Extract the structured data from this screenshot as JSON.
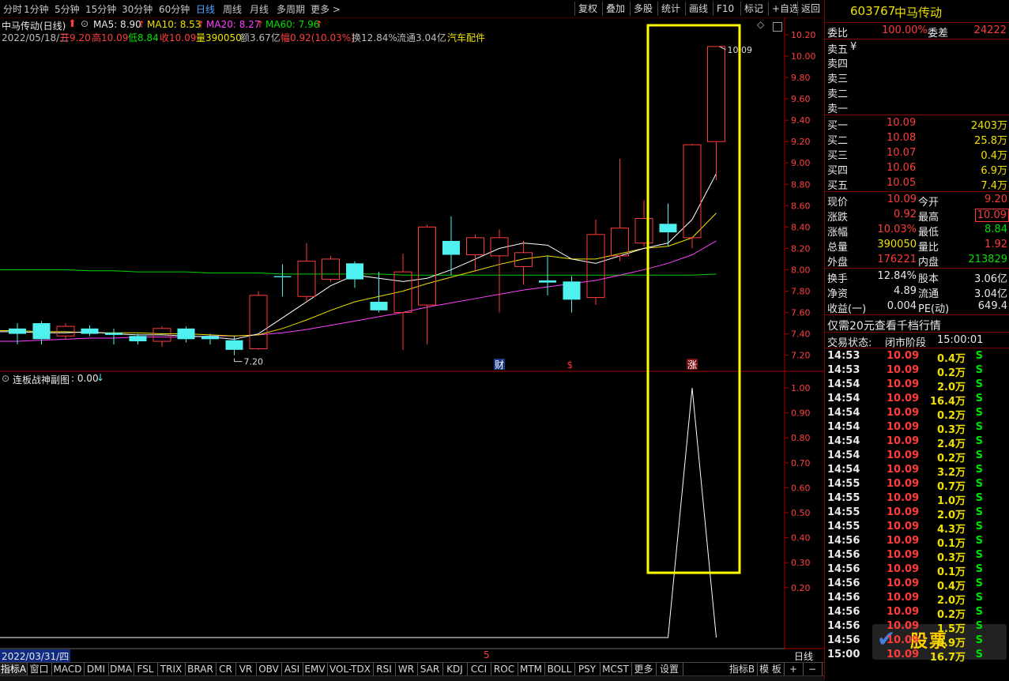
{
  "topbar": {
    "periods": [
      "分时",
      "1分钟",
      "5分钟",
      "15分钟",
      "30分钟",
      "60分钟",
      "日线",
      "周线",
      "月线",
      "多周期",
      "更多 >"
    ],
    "active_index": 6,
    "tools": [
      "复权",
      "叠加",
      "多股",
      "统计",
      "画线",
      "F10",
      "标记",
      "+自选",
      "返回"
    ]
  },
  "info": {
    "title": "中马传动(日线)",
    "ma5": "MA5: 8.90",
    "ma10": "MA10: 8.53",
    "ma20": "MA20: 8.27",
    "ma60": "MA60: 7.96",
    "date": "2022/05/18/三",
    "open": "开9.20",
    "high": "高10.09",
    "low": "低8.84",
    "close": "收10.09",
    "vol": "量390050",
    "amount": "额3.67亿",
    "change": "幅0.92(10.03%)",
    "turnover": "换12.84%",
    "float": "流通3.04亿",
    "sector": "汽车配件"
  },
  "sub": {
    "title": "连板战神副图",
    "value": ": 0.00",
    "arrow": "↓"
  },
  "colors": {
    "up": "#ff3c3c",
    "down": "#4ff0f0",
    "ma5": "#ffffff",
    "ma10": "#f0e000",
    "ma20": "#ff40ff",
    "ma60": "#00d000",
    "highlight": "#ffff00",
    "axis": "#aa0000"
  },
  "chart_data": {
    "type": "candlestick",
    "y_ticks": [
      "10.20",
      "10.00",
      "9.80",
      "9.60",
      "9.40",
      "9.20",
      "9.00",
      "8.80",
      "8.60",
      "8.40",
      "8.20",
      "8.00",
      "7.80",
      "7.60",
      "7.40",
      "7.20"
    ],
    "ylim": [
      7.1,
      10.3
    ],
    "candles": [
      {
        "o": 7.45,
        "h": 7.5,
        "l": 7.3,
        "c": 7.4
      },
      {
        "o": 7.5,
        "h": 7.52,
        "l": 7.3,
        "c": 7.35
      },
      {
        "o": 7.38,
        "h": 7.5,
        "l": 7.35,
        "c": 7.47
      },
      {
        "o": 7.45,
        "h": 7.48,
        "l": 7.38,
        "c": 7.4
      },
      {
        "o": 7.41,
        "h": 7.45,
        "l": 7.3,
        "c": 7.39
      },
      {
        "o": 7.38,
        "h": 7.4,
        "l": 7.3,
        "c": 7.33
      },
      {
        "o": 7.33,
        "h": 7.47,
        "l": 7.28,
        "c": 7.45
      },
      {
        "o": 7.45,
        "h": 7.47,
        "l": 7.32,
        "c": 7.35
      },
      {
        "o": 7.38,
        "h": 7.4,
        "l": 7.3,
        "c": 7.35
      },
      {
        "o": 7.34,
        "h": 7.38,
        "l": 7.2,
        "c": 7.25
      },
      {
        "o": 7.26,
        "h": 7.8,
        "l": 7.25,
        "c": 7.76
      },
      {
        "o": 7.94,
        "h": 8.05,
        "l": 7.75,
        "c": 7.93
      },
      {
        "o": 7.75,
        "h": 8.25,
        "l": 7.7,
        "c": 8.08
      },
      {
        "o": 7.91,
        "h": 8.13,
        "l": 7.89,
        "c": 8.1
      },
      {
        "o": 8.06,
        "h": 8.08,
        "l": 7.83,
        "c": 7.91
      },
      {
        "o": 7.7,
        "h": 7.98,
        "l": 7.6,
        "c": 7.62
      },
      {
        "o": 7.6,
        "h": 8.15,
        "l": 7.25,
        "c": 7.98
      },
      {
        "o": 7.67,
        "h": 8.42,
        "l": 7.3,
        "c": 8.4
      },
      {
        "o": 8.27,
        "h": 8.5,
        "l": 7.95,
        "c": 8.14
      },
      {
        "o": 8.14,
        "h": 8.33,
        "l": 7.98,
        "c": 8.3
      },
      {
        "o": 8.13,
        "h": 8.38,
        "l": 7.6,
        "c": 8.3
      },
      {
        "o": 8.03,
        "h": 8.27,
        "l": 7.86,
        "c": 8.16
      },
      {
        "o": 7.9,
        "h": 8.13,
        "l": 7.76,
        "c": 7.88
      },
      {
        "o": 7.89,
        "h": 7.94,
        "l": 7.6,
        "c": 7.72
      },
      {
        "o": 7.74,
        "h": 8.47,
        "l": 7.67,
        "c": 8.33
      },
      {
        "o": 8.13,
        "h": 9.04,
        "l": 8.08,
        "c": 8.39
      },
      {
        "o": 8.25,
        "h": 8.65,
        "l": 8.22,
        "c": 8.48
      },
      {
        "o": 8.43,
        "h": 8.62,
        "l": 8.22,
        "c": 8.35
      },
      {
        "o": 8.3,
        "h": 9.18,
        "l": 8.2,
        "c": 9.17
      },
      {
        "o": 9.2,
        "h": 10.09,
        "l": 8.84,
        "c": 10.09
      }
    ],
    "ma5": [
      7.42,
      7.41,
      7.41,
      7.42,
      7.4,
      7.39,
      7.39,
      7.38,
      7.37,
      7.35,
      7.4,
      7.55,
      7.7,
      7.85,
      7.95,
      7.92,
      7.89,
      7.92,
      8.0,
      8.1,
      8.2,
      8.25,
      8.23,
      8.1,
      8.06,
      8.13,
      8.2,
      8.25,
      8.47,
      8.9
    ],
    "ma10": [
      7.43,
      7.42,
      7.42,
      7.41,
      7.41,
      7.41,
      7.4,
      7.4,
      7.39,
      7.38,
      7.39,
      7.45,
      7.53,
      7.62,
      7.7,
      7.75,
      7.8,
      7.87,
      7.93,
      7.99,
      8.05,
      8.1,
      8.13,
      8.1,
      8.1,
      8.15,
      8.2,
      8.22,
      8.3,
      8.53
    ],
    "ma20": [
      7.33,
      7.34,
      7.35,
      7.36,
      7.36,
      7.37,
      7.37,
      7.37,
      7.38,
      7.38,
      7.39,
      7.41,
      7.44,
      7.48,
      7.52,
      7.56,
      7.6,
      7.65,
      7.69,
      7.73,
      7.77,
      7.81,
      7.84,
      7.87,
      7.9,
      7.95,
      8.0,
      8.06,
      8.14,
      8.27
    ],
    "ma60": [
      8.0,
      8.0,
      8.0,
      7.99,
      7.99,
      7.98,
      7.98,
      7.98,
      7.97,
      7.97,
      7.97,
      7.96,
      7.96,
      7.96,
      7.96,
      7.96,
      7.95,
      7.95,
      7.95,
      7.95,
      7.95,
      7.95,
      7.95,
      7.95,
      7.95,
      7.95,
      7.95,
      7.95,
      7.95,
      7.96
    ],
    "low_label": "7.20",
    "high_label": "10.09",
    "sub_ticks": [
      "1.00",
      "0.90",
      "0.80",
      "0.70",
      "0.60",
      "0.50",
      "0.40",
      "0.30",
      "0.20"
    ],
    "sub_values": [
      0,
      0,
      0,
      0,
      0,
      0,
      0,
      0,
      0,
      0,
      0,
      0,
      0,
      0,
      0,
      0,
      0,
      0,
      0,
      0,
      0,
      0,
      0,
      0,
      0,
      0,
      0,
      0,
      1,
      0
    ],
    "markers": [
      {
        "i": 20,
        "text": "财"
      },
      {
        "i": 23,
        "text": "$"
      },
      {
        "i": 28,
        "text": "涨"
      }
    ],
    "start_date": "2022/03/31/四",
    "x_mark": "5"
  },
  "tabs": [
    "指标A",
    "窗口",
    "MACD",
    "DMI",
    "DMA",
    "FSL",
    "TRIX",
    "BRAR",
    "CR",
    "VR",
    "OBV",
    "ASI",
    "EMV",
    "VOL-TDX",
    "RSI",
    "WR",
    "SAR",
    "KDJ",
    "CCI",
    "ROC",
    "MTM",
    "BOLL",
    "PSY",
    "MCST",
    "更多",
    "设置",
    "指标B",
    "模 板"
  ],
  "period_right": "日线",
  "right": {
    "code": "603767",
    "name": "中马传动",
    "weibi_label": "委比",
    "weibi": "100.00%",
    "weicha_label": "委差",
    "weicha": "24222",
    "sell": [
      {
        "label": "卖五",
        "extra": "¥"
      },
      {
        "label": "卖四",
        "extra": ""
      },
      {
        "label": "卖三",
        "extra": ""
      },
      {
        "label": "卖二",
        "extra": ""
      },
      {
        "label": "卖一",
        "extra": ""
      }
    ],
    "buy": [
      {
        "label": "买一",
        "price": "10.09",
        "vol": "2403万"
      },
      {
        "label": "买二",
        "price": "10.08",
        "vol": "25.8万"
      },
      {
        "label": "买三",
        "price": "10.07",
        "vol": "0.4万"
      },
      {
        "label": "买四",
        "price": "10.06",
        "vol": "6.9万"
      },
      {
        "label": "买五",
        "price": "10.05",
        "vol": "7.4万"
      }
    ],
    "quote": [
      {
        "l1": "现价",
        "v1": "10.09",
        "c1": "red",
        "l2": "今开",
        "v2": "9.20",
        "c2": "red"
      },
      {
        "l1": "涨跌",
        "v1": "0.92",
        "c1": "red",
        "l2": "最高",
        "v2": "10.09",
        "c2": "red"
      },
      {
        "l1": "涨幅",
        "v1": "10.03%",
        "c1": "red",
        "l2": "最低",
        "v2": "8.84",
        "c2": "green"
      },
      {
        "l1": "总量",
        "v1": "390050",
        "c1": "yellow",
        "l2": "量比",
        "v2": "1.92",
        "c2": "red"
      },
      {
        "l1": "外盘",
        "v1": "176221",
        "c1": "red",
        "l2": "内盘",
        "v2": "213829",
        "c2": "green"
      }
    ],
    "fund": [
      {
        "l1": "换手",
        "v1": "12.84%",
        "l2": "股本",
        "v2": "3.06亿"
      },
      {
        "l1": "净资",
        "v1": "4.89",
        "l2": "流通",
        "v2": "3.04亿"
      },
      {
        "l1": "收益(一)",
        "v1": "0.004",
        "l2": "PE(动)",
        "v2": "649.4"
      }
    ],
    "promo": "仅需20元查看千档行情",
    "status_label": "交易状态:",
    "status": "闭市阶段",
    "status_time": "15:00:01",
    "ticks": [
      {
        "t": "14:53",
        "p": "10.09",
        "v": "0.4万",
        "s": "S"
      },
      {
        "t": "14:53",
        "p": "10.09",
        "v": "0.2万",
        "s": "S"
      },
      {
        "t": "14:54",
        "p": "10.09",
        "v": "2.0万",
        "s": "S"
      },
      {
        "t": "14:54",
        "p": "10.09",
        "v": "16.4万",
        "s": "S"
      },
      {
        "t": "14:54",
        "p": "10.09",
        "v": "0.2万",
        "s": "S"
      },
      {
        "t": "14:54",
        "p": "10.09",
        "v": "0.3万",
        "s": "S"
      },
      {
        "t": "14:54",
        "p": "10.09",
        "v": "2.4万",
        "s": "S"
      },
      {
        "t": "14:54",
        "p": "10.09",
        "v": "0.2万",
        "s": "S"
      },
      {
        "t": "14:54",
        "p": "10.09",
        "v": "3.2万",
        "s": "S"
      },
      {
        "t": "14:55",
        "p": "10.09",
        "v": "0.7万",
        "s": "S"
      },
      {
        "t": "14:55",
        "p": "10.09",
        "v": "1.0万",
        "s": "S"
      },
      {
        "t": "14:55",
        "p": "10.09",
        "v": "2.0万",
        "s": "S"
      },
      {
        "t": "14:55",
        "p": "10.09",
        "v": "4.3万",
        "s": "S"
      },
      {
        "t": "14:56",
        "p": "10.09",
        "v": "0.1万",
        "s": "S"
      },
      {
        "t": "14:56",
        "p": "10.09",
        "v": "0.3万",
        "s": "S"
      },
      {
        "t": "14:56",
        "p": "10.09",
        "v": "0.1万",
        "s": "S"
      },
      {
        "t": "14:56",
        "p": "10.09",
        "v": "0.4万",
        "s": "S"
      },
      {
        "t": "14:56",
        "p": "10.09",
        "v": "2.0万",
        "s": "S"
      },
      {
        "t": "14:56",
        "p": "10.09",
        "v": "0.2万",
        "s": "S"
      },
      {
        "t": "14:56",
        "p": "10.09",
        "v": "1.5万",
        "s": "S"
      },
      {
        "t": "14:56",
        "p": "10.09",
        "v": "0.9万",
        "s": "S"
      },
      {
        "t": "15:00",
        "p": "10.09",
        "v": "16.7万",
        "s": "S"
      }
    ]
  }
}
